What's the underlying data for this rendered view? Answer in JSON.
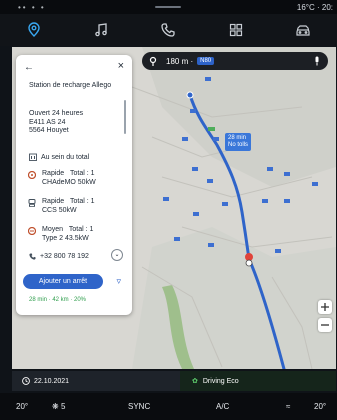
{
  "status_bar": {
    "left_indicators": "•• • •",
    "temp_time": "16°C · 20:"
  },
  "nav": {
    "items": [
      {
        "name": "navigation",
        "icon": "location-pin-icon",
        "active": true
      },
      {
        "name": "music",
        "icon": "music-note-icon",
        "active": false
      },
      {
        "name": "phone",
        "icon": "phone-icon",
        "active": false
      },
      {
        "name": "apps",
        "icon": "apps-grid-icon",
        "active": false
      },
      {
        "name": "vehicle",
        "icon": "car-icon",
        "active": false
      }
    ]
  },
  "map": {
    "search": {
      "distance": "180 m ·",
      "road": "N80"
    },
    "route_info": {
      "line1": "28 min",
      "line2": "No tolls"
    }
  },
  "card": {
    "station_name": "Station de recharge Allego",
    "hours": "Ouvert 24 heures",
    "road": "E411 AS 24",
    "city": "5564 Houyet",
    "amenity": "Au sein du total",
    "plugs": [
      {
        "speed": "Rapide",
        "total": "Total : 1",
        "type": "CHAdeMO  50kW",
        "icon": "chademo-plug-icon"
      },
      {
        "speed": "Rapide",
        "total": "Total : 1",
        "type": "CCS  50kW",
        "icon": "ccs-plug-icon"
      },
      {
        "speed": "Moyen",
        "total": "Total : 1",
        "type": "Type 2 43.5kW",
        "icon": "type2-plug-icon"
      }
    ],
    "phone": "+32 800 78 192",
    "add_stop": "Ajouter un arrêt",
    "eta": "28 min · 42 km · 20%"
  },
  "info_bar": {
    "date": "22.10.2021",
    "eco_mode": "Driving Eco"
  },
  "climate": {
    "left_temp": "20°",
    "fan": "5",
    "sync": "SYNC",
    "ac": "A/C",
    "right_temp": "20°"
  },
  "colors": {
    "accent": "#39a7f0",
    "route": "#2f64c9",
    "eco": "#5fd06e"
  }
}
